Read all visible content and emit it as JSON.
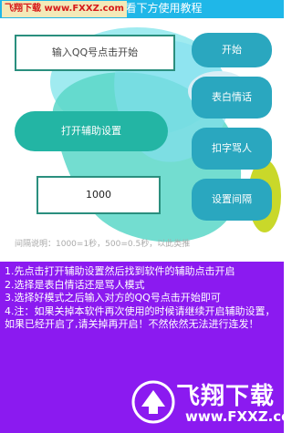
{
  "header": {
    "title": "译讲砌戏看下方使用教程",
    "watermark": "飞翔下载 www.FXXZ.com"
  },
  "main": {
    "qq_input_placeholder": "输入QQ号点击开始",
    "start_button": "开始",
    "biaobai_button": "表白情话",
    "assist_button": "打开辅助设置",
    "kouzi_button": "扣字骂人",
    "interval_value": "1000",
    "interval_button": "设置间隔",
    "interval_note": "间隔说明：1000=1秒，500=0.5秒，以此类推"
  },
  "instructions": [
    "1.先点击打开辅助设置然后找到软件的辅助点击开启",
    "2.选择是表白情话还是骂人模式",
    "3.选择好模式之后输入对方的QQ号点击开始即可",
    " 4.注：如果关掉本软件再次使用的时候请继续开启辅助设置，如果已经开启了,请关掉再开启！不然依然无法进行连发！"
  ],
  "logo": {
    "word": "飞翔下载",
    "url": "www.FXXZ.com"
  },
  "colors": {
    "header_bg": "#1fb7e8",
    "button": "#2aa7bf",
    "panel_bg": "#8b1af0"
  }
}
